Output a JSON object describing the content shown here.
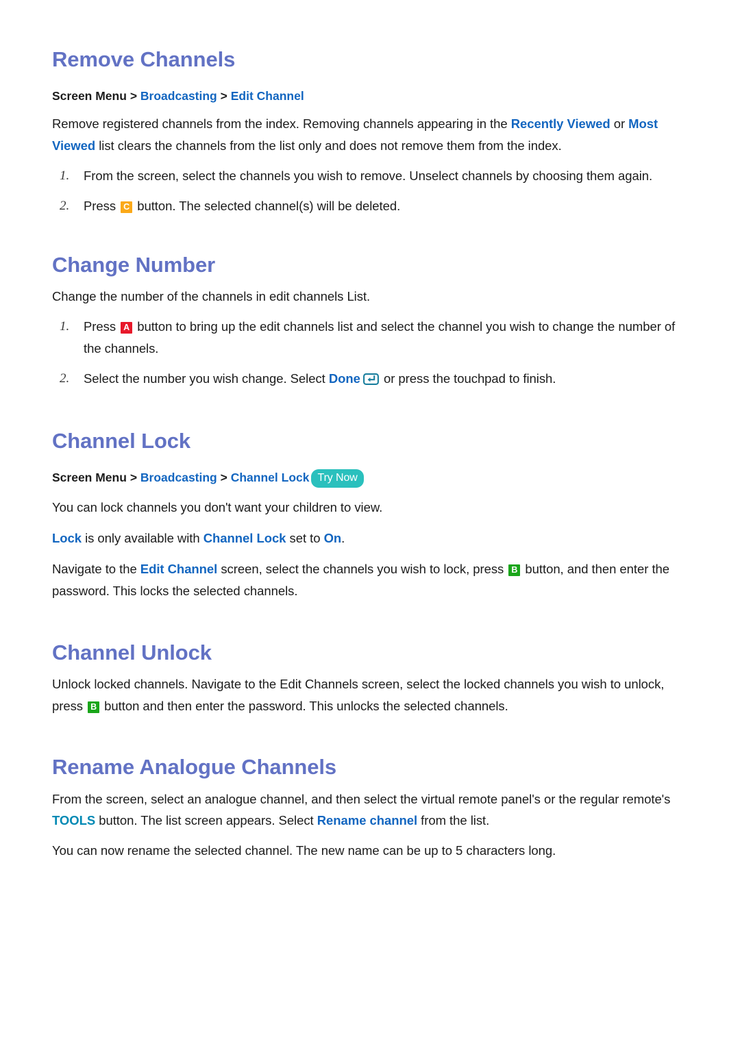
{
  "document": {
    "background": "#ffffff",
    "heading_color": "#6272c4",
    "link_color": "#1366c0",
    "link_cyan_color": "#0089b4",
    "text_color": "#1c1c1c"
  },
  "badges": {
    "a": {
      "label": "A",
      "color": "#e8182a"
    },
    "b": {
      "label": "B",
      "color": "#1aa61a"
    },
    "c": {
      "label": "C",
      "color": "#fba919"
    },
    "try_now": {
      "label": "Try Now",
      "color": "#2ac0bd"
    },
    "enter_key": {
      "name": "enter-key-icon",
      "color": "#1a7f9e"
    }
  },
  "sections": {
    "remove_channels": {
      "title": "Remove Channels",
      "breadcrumb": {
        "root": "Screen Menu",
        "sep": ">",
        "item1": "Broadcasting",
        "item2": "Edit Channel"
      },
      "intro": {
        "part1": "Remove registered channels from the index. Removing channels appearing in the ",
        "link1": "Recently Viewed",
        "part2": " or ",
        "link2": "Most Viewed",
        "part3": " list clears the channels from the list only and does not remove them from the index."
      },
      "steps": [
        {
          "num": "1.",
          "text": "From the screen, select the channels you wish to remove. Unselect channels by choosing them again."
        },
        {
          "num": "2.",
          "pre": "Press ",
          "badge": "C",
          "post": " button. The selected channel(s) will be deleted."
        }
      ]
    },
    "change_number": {
      "title": "Change Number",
      "intro": "Change the number of the channels in edit channels List.",
      "steps": [
        {
          "num": "1.",
          "pre": "Press ",
          "badge": "A",
          "post": " button to bring up the edit channels list and select the channel you wish to change the number of the channels."
        },
        {
          "num": "2.",
          "pre": "Select the number you wish change. Select ",
          "link": "Done",
          "post": " or press the touchpad to finish."
        }
      ]
    },
    "channel_lock": {
      "title": "Channel Lock",
      "breadcrumb": {
        "root": "Screen Menu",
        "sep": ">",
        "item1": "Broadcasting",
        "item2": "Channel Lock",
        "try_now": "Try Now"
      },
      "para1": "You can lock channels you don't want your children to view.",
      "para2": {
        "link1": "Lock",
        "mid1": " is only available with ",
        "link2": "Channel Lock",
        "mid2": " set to ",
        "link3": "On",
        "end": "."
      },
      "para3": {
        "pre": "Navigate to the ",
        "link1": "Edit Channel",
        "mid": " screen, select the channels you wish to lock, press ",
        "badge": "B",
        "post": " button, and then enter the password. This locks the selected channels."
      }
    },
    "channel_unlock": {
      "title": "Channel Unlock",
      "para": {
        "pre": "Unlock locked channels. Navigate to the Edit Channels screen, select the locked channels you wish to unlock, press ",
        "badge": "B",
        "post": " button and then enter the password. This unlocks the selected channels."
      }
    },
    "rename_analogue_channels": {
      "title": "Rename Analogue Channels",
      "para1": {
        "pre": "From the screen, select an analogue channel, and then select the virtual remote panel's or the regular remote's ",
        "link1": "TOOLS",
        "mid": " button. The list screen appears. Select ",
        "link2": "Rename channel",
        "post": " from the list."
      },
      "para2": "You can now rename the selected channel. The new name can be up to 5 characters long."
    }
  }
}
